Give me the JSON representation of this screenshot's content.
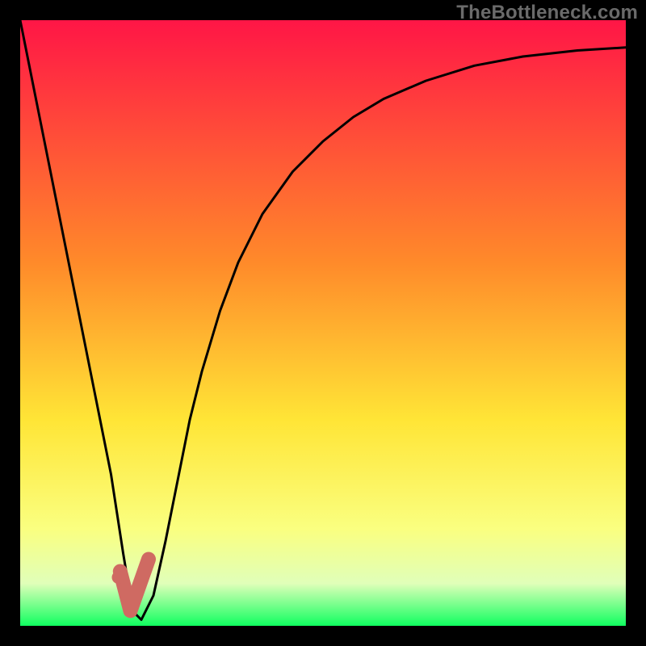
{
  "watermark": "TheBottleneck.com",
  "colors": {
    "bg": "#000000",
    "grad_top": "#ff1646",
    "grad_mid1": "#ff8a2a",
    "grad_mid2": "#ffe536",
    "grad_low1": "#faff80",
    "grad_low2": "#e0ffb9",
    "grad_bottom": "#10ff60",
    "curve": "#000000",
    "marker_fill": "#cf6a62",
    "marker_stroke": "#cf6a62"
  },
  "chart_data": {
    "type": "line",
    "title": "",
    "xlabel": "",
    "ylabel": "",
    "xlim": [
      0,
      100
    ],
    "ylim": [
      0,
      100
    ],
    "series": [
      {
        "name": "bottleneck-curve",
        "x": [
          0,
          3,
          6,
          9,
          12,
          15,
          17,
          18,
          19,
          20,
          22,
          24,
          26,
          28,
          30,
          33,
          36,
          40,
          45,
          50,
          55,
          60,
          67,
          75,
          83,
          92,
          100
        ],
        "y": [
          100,
          85,
          70,
          55,
          40,
          25,
          12,
          6,
          2,
          1,
          5,
          14,
          24,
          34,
          42,
          52,
          60,
          68,
          75,
          80,
          84,
          87,
          90,
          92.5,
          94,
          95,
          95.5
        ]
      }
    ],
    "marker": {
      "name": "selected-point-checkmark",
      "x": 18.5,
      "y": 3,
      "path": [
        {
          "x": 16.5,
          "y": 9
        },
        {
          "x": 18.2,
          "y": 2.5
        },
        {
          "x": 21.2,
          "y": 11
        }
      ],
      "dot": {
        "x": 16.2,
        "y": 8
      }
    }
  }
}
